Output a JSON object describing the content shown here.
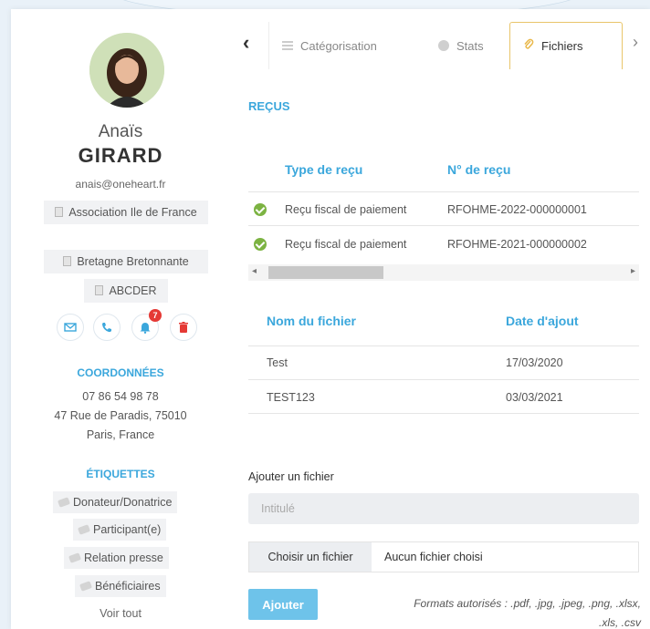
{
  "profile": {
    "first_name": "Anaïs",
    "last_name": "GIRARD",
    "email": "anais@oneheart.fr",
    "organizations": [
      "Association Ile de France",
      "Bretagne Bretonnante",
      "ABCDER"
    ],
    "notification_count": "7",
    "coordinates_title": "COORDONNÉES",
    "phone": "07 86 54 98 78",
    "address_line1": "47 Rue de Paradis, 75010",
    "address_line2": "Paris, France",
    "tags_title": "ÉTIQUETTES",
    "tags": [
      "Donateur/Donatrice",
      "Participant(e)",
      "Relation presse",
      "Bénéficiaires"
    ],
    "see_all": "Voir tout"
  },
  "tabs": {
    "items": [
      {
        "label": "Catégorisation",
        "icon": "list-icon"
      },
      {
        "label": "Stats",
        "icon": "stats-icon"
      },
      {
        "label": "Fichiers",
        "icon": "paperclip-icon",
        "active": true
      }
    ]
  },
  "receipts": {
    "title": "REÇUS",
    "columns": [
      "Type de reçu",
      "N° de reçu"
    ],
    "rows": [
      {
        "type": "Reçu fiscal de paiement",
        "number": "RFOHME-2022-000000001"
      },
      {
        "type": "Reçu fiscal de paiement",
        "number": "RFOHME-2021-000000002"
      }
    ]
  },
  "files": {
    "columns": [
      "Nom du fichier",
      "Date d'ajout"
    ],
    "rows": [
      {
        "name": "Test",
        "date": "17/03/2020"
      },
      {
        "name": "TEST123",
        "date": "03/03/2021"
      }
    ]
  },
  "upload": {
    "label": "Ajouter un fichier",
    "title_placeholder": "Intitulé",
    "choose_button": "Choisir un fichier",
    "no_file": "Aucun fichier choisi",
    "add_button": "Ajouter",
    "formats_line1": "Formats autorisés : .pdf, .jpg, .jpeg, .png, .xlsx,",
    "formats_line2": ".xls, .csv"
  },
  "colors": {
    "accent": "#3ba7dc",
    "active_tab_border": "#e9c56a",
    "success": "#7cb342",
    "button": "#6ec3ea",
    "badge": "#e53935"
  }
}
